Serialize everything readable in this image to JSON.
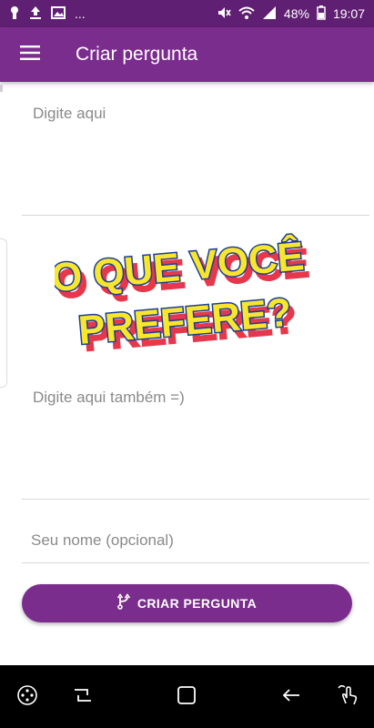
{
  "status_bar": {
    "battery": "48%",
    "time": "19:07",
    "more": "...",
    "icons": [
      "keyhole-icon",
      "upload-icon",
      "image-icon",
      "mute-icon",
      "wifi-icon",
      "signal-icon",
      "battery-icon"
    ]
  },
  "app_bar": {
    "title": "Criar pergunta",
    "menu_icon": "hamburger-menu-icon",
    "color": "#7b2d8e"
  },
  "form": {
    "option_a_placeholder": "Digite aqui",
    "option_b_placeholder": "Digite aqui também =)",
    "name_placeholder": "Seu nome (opcional)"
  },
  "banner": {
    "line1": "O QUE VOCÊ",
    "line2": "PREFERE?",
    "fill_color": "#f7e62c",
    "outline_color": "#1b3c97",
    "shadow_color": "#e5384b"
  },
  "create_button": {
    "label": "CRIAR PERGUNTA",
    "icon": "fork-icon"
  },
  "nav_bar": {
    "icons": [
      "dpad-icon",
      "recent-apps-icon",
      "home-icon",
      "back-icon",
      "gesture-icon"
    ]
  }
}
